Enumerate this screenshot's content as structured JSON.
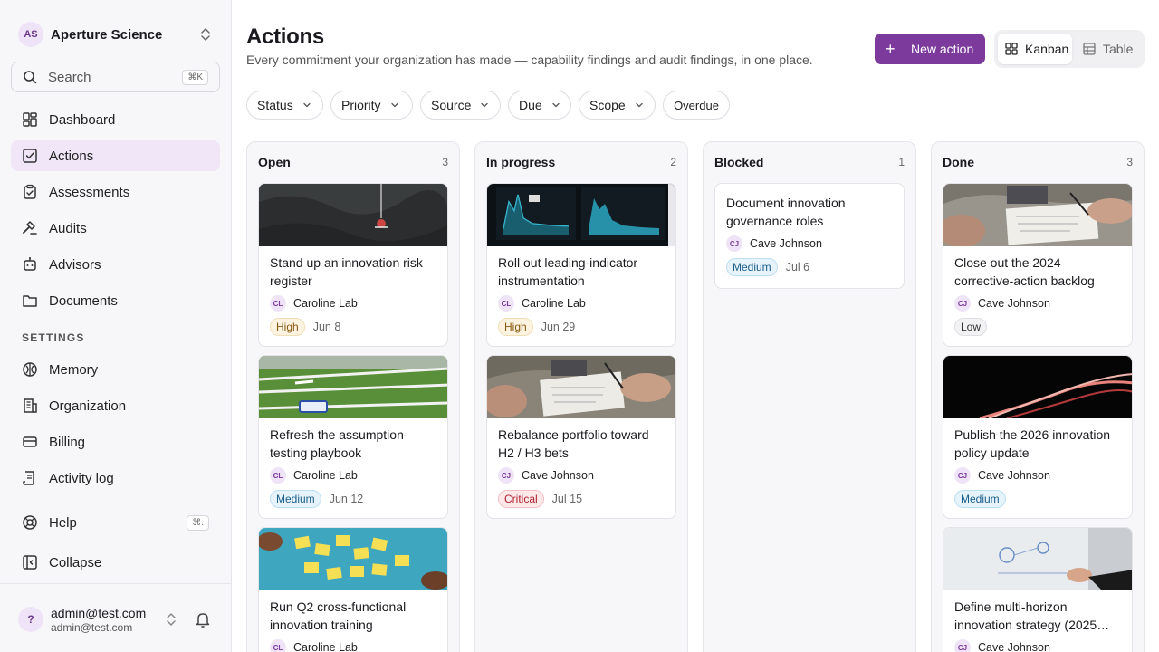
{
  "sidebar": {
    "org": {
      "initials": "AS",
      "name": "Aperture Science"
    },
    "search": {
      "label": "Search",
      "shortcut": "⌘K"
    },
    "nav": [
      {
        "label": "Dashboard",
        "icon": "dashboard-icon"
      },
      {
        "label": "Actions",
        "icon": "actions-icon",
        "active": true
      },
      {
        "label": "Assessments",
        "icon": "assessments-icon"
      },
      {
        "label": "Audits",
        "icon": "audits-icon"
      },
      {
        "label": "Advisors",
        "icon": "advisors-icon"
      },
      {
        "label": "Documents",
        "icon": "documents-icon"
      }
    ],
    "settings_label": "SETTINGS",
    "settings": [
      {
        "label": "Memory",
        "icon": "memory-icon"
      },
      {
        "label": "Organization",
        "icon": "organization-icon"
      },
      {
        "label": "Billing",
        "icon": "billing-icon"
      },
      {
        "label": "Activity log",
        "icon": "activity-log-icon"
      }
    ],
    "help": {
      "label": "Help",
      "shortcut": "⌘."
    },
    "collapse": {
      "label": "Collapse"
    },
    "user": {
      "initials": "?",
      "name": "admin@test.com",
      "email": "admin@test.com"
    }
  },
  "header": {
    "title": "Actions",
    "subtitle": "Every commitment your organization has made — capability findings and audit findings, in one place.",
    "new_action": "New action",
    "views": {
      "kanban": "Kanban",
      "table": "Table",
      "selected": "Kanban"
    }
  },
  "filters": [
    "Status",
    "Priority",
    "Source",
    "Due",
    "Scope",
    "Overdue"
  ],
  "columns": [
    {
      "title": "Open",
      "count": "3",
      "cards": [
        {
          "title": "Stand up an innovation risk register",
          "owner_initials": "CL",
          "owner": "Caroline Lab",
          "priority": "High",
          "due": "Jun 8"
        },
        {
          "title": "Refresh the assumption-testing playbook",
          "owner_initials": "CL",
          "owner": "Caroline Lab",
          "priority": "Medium",
          "due": "Jun 12"
        },
        {
          "title": "Run Q2 cross-functional innovation training",
          "owner_initials": "CL",
          "owner": "Caroline Lab"
        }
      ]
    },
    {
      "title": "In progress",
      "count": "2",
      "cards": [
        {
          "title": "Roll out leading-indicator instrumentation",
          "owner_initials": "CL",
          "owner": "Caroline Lab",
          "priority": "High",
          "due": "Jun 29"
        },
        {
          "title": "Rebalance portfolio toward H2 / H3 bets",
          "owner_initials": "CJ",
          "owner": "Cave Johnson",
          "priority": "Critical",
          "due": "Jul 15"
        }
      ]
    },
    {
      "title": "Blocked",
      "count": "1",
      "cards": [
        {
          "title": "Document innovation governance roles",
          "owner_initials": "CJ",
          "owner": "Cave Johnson",
          "priority": "Medium",
          "due": "Jul 6"
        }
      ]
    },
    {
      "title": "Done",
      "count": "3",
      "cards": [
        {
          "title": "Close out the 2024 corrective-action backlog",
          "owner_initials": "CJ",
          "owner": "Cave Johnson",
          "priority": "Low"
        },
        {
          "title": "Publish the 2026 innovation policy update",
          "owner_initials": "CJ",
          "owner": "Cave Johnson",
          "priority": "Medium"
        },
        {
          "title": "Define multi-horizon innovation strategy (2025…",
          "owner_initials": "CJ",
          "owner": "Cave Johnson"
        }
      ]
    }
  ],
  "colors": {
    "accent": "#7c3a9c",
    "active_nav": "#f1e6f7"
  }
}
